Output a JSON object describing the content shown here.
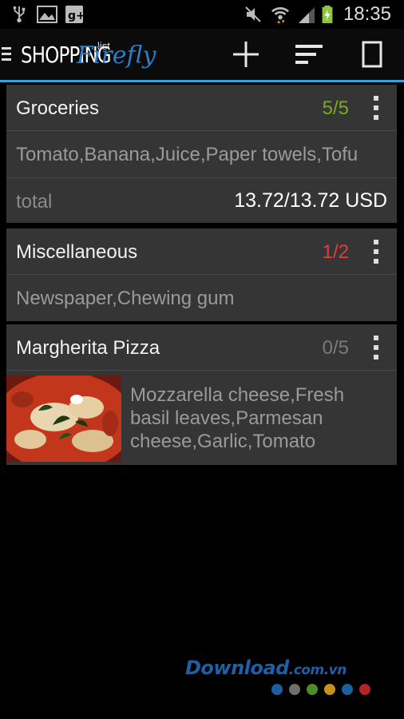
{
  "status_bar": {
    "time": "18:35",
    "icons": [
      "usb-icon",
      "image-icon",
      "google-plus-icon",
      "mute-icon",
      "wifi-icon",
      "signal-icon",
      "battery-charging-icon"
    ]
  },
  "action_bar": {
    "app_title": "SHOPPING",
    "app_title_sub": "list",
    "app_title_script": "Firefly",
    "buttons": [
      "add-icon",
      "sort-icon",
      "checklist-icon"
    ],
    "accent_color": "#33a5d5"
  },
  "lists": [
    {
      "title": "Groceries",
      "count": "5/5",
      "count_color": "#7aaa1e",
      "items": "Tomato,Banana,Juice,Paper towels,Tofu",
      "total_label": "total",
      "total_value": "13.72/13.72 USD"
    },
    {
      "title": "Miscellaneous",
      "count": "1/2",
      "count_color": "#e83b3b",
      "items": "Newspaper,Chewing gum"
    },
    {
      "title": "Margherita Pizza",
      "count": "0/5",
      "count_color": "#7a7a7a",
      "items": "Mozzarella cheese,Fresh basil leaves,Parmesan cheese,Garlic,Tomato",
      "image": "pizza-photo"
    }
  ],
  "watermark": {
    "text": "Download",
    "suffix": ".com.vn",
    "dot_colors": [
      "#1c5fa0",
      "#6e6e6e",
      "#4f8a2a",
      "#c8901c",
      "#1c5fa0",
      "#b52424"
    ]
  }
}
